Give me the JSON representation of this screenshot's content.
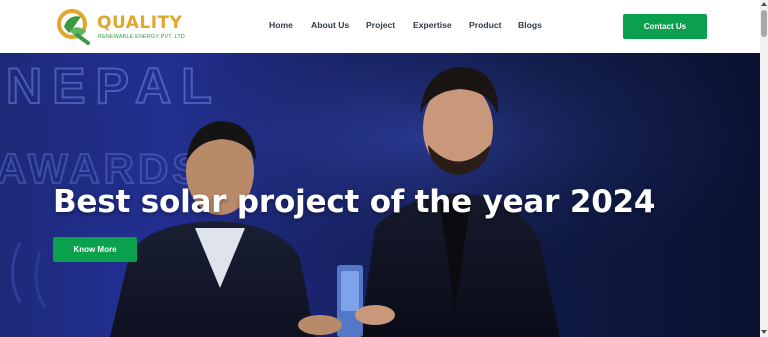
{
  "brand": {
    "name": "QUALITY",
    "tagline": "RENEWABLE ENERGY PVT. LTD."
  },
  "nav": {
    "items": [
      {
        "label": "Home"
      },
      {
        "label": "About Us"
      },
      {
        "label": "Project"
      },
      {
        "label": "Expertise"
      },
      {
        "label": "Product"
      },
      {
        "label": "Blogs"
      }
    ],
    "cta_label": "Contact Us"
  },
  "hero": {
    "backdrop_text": [
      "NEPAL",
      "AWARDS"
    ],
    "title": "Best solar project of the year 2024",
    "button_label": "Know More"
  },
  "colors": {
    "accent_green": "#0aa04e",
    "brand_gold": "#e0a82a",
    "brand_green": "#3a9b43",
    "nav_text": "#2f3b4a",
    "hero_blue": "#1d2a78"
  },
  "icons": {
    "logo": "leaf-q-logo-icon",
    "scroll_up": "triangle-up-icon",
    "scroll_down": "triangle-down-icon"
  }
}
